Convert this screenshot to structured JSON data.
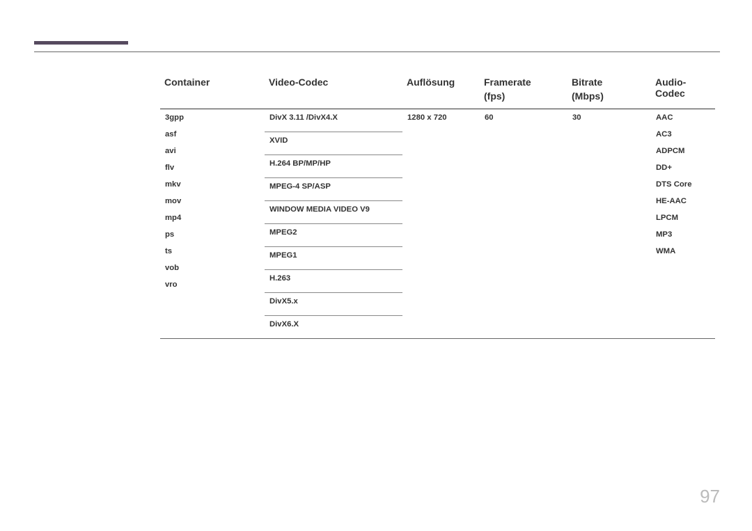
{
  "headers": {
    "container": "Container",
    "video": "Video-Codec",
    "aufl": "Auflösung",
    "frame": "Framerate",
    "frame_unit": "(fps)",
    "bitrate": "Bitrate",
    "bitrate_unit": "(Mbps)",
    "audio": "Audio-Codec"
  },
  "row": {
    "container": [
      "3gpp",
      "asf",
      "avi",
      "flv",
      "mkv",
      "mov",
      "mp4",
      "ps",
      "ts",
      "vob",
      "vro"
    ],
    "video": [
      "DivX 3.11 /DivX4.X",
      "XVID",
      "H.264 BP/MP/HP",
      "MPEG-4 SP/ASP",
      "WINDOW MEDIA VIDEO V9",
      "MPEG2",
      "MPEG1",
      "H.263",
      "DivX5.x",
      "DivX6.X"
    ],
    "aufl": "1280 x 720",
    "frame": "60",
    "bitrate": "30",
    "audio": [
      "AAC",
      "AC3",
      "ADPCM",
      "DD+",
      "DTS Core",
      "HE-AAC",
      "LPCM",
      "MP3",
      "WMA"
    ]
  },
  "page_number": "97"
}
